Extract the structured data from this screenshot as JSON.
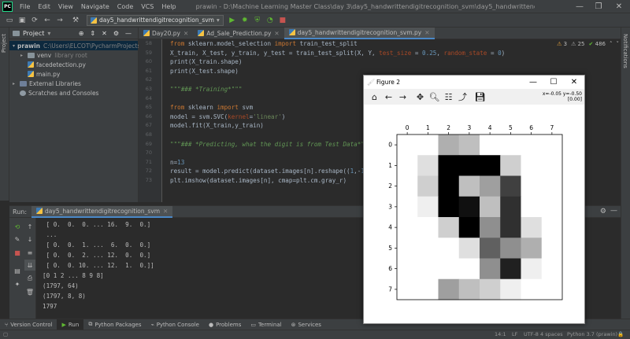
{
  "menu": {
    "items": [
      "File",
      "Edit",
      "View",
      "Navigate",
      "Code",
      "VCS",
      "Help"
    ],
    "title": "prawin - D:\\Machine Learning Master Class\\day 3\\day5_handwrittendigitrecognition_svm\\day5_handwrittendigitrecognition_svm.py"
  },
  "toolbar": {
    "run_config": "day5_handwrittendigitrecognition_svm"
  },
  "strips": {
    "left": "Project",
    "right": "Notifications"
  },
  "project": {
    "header": "Project",
    "nodes": [
      {
        "label": "prawin",
        "extra": "C:\\Users\\ELCOT\\PycharmProjects\\pr",
        "indent": 0,
        "kind": "folder-yellow",
        "arrow": "▾"
      },
      {
        "label": "venv",
        "extra": "library root",
        "indent": 1,
        "kind": "folder",
        "arrow": "▸"
      },
      {
        "label": "facedetection.py",
        "extra": "",
        "indent": 1,
        "kind": "py",
        "arrow": ""
      },
      {
        "label": "main.py",
        "extra": "",
        "indent": 1,
        "kind": "py",
        "arrow": ""
      },
      {
        "label": "External Libraries",
        "extra": "",
        "indent": 0,
        "kind": "lib",
        "arrow": "▸"
      },
      {
        "label": "Scratches and Consoles",
        "extra": "",
        "indent": 0,
        "kind": "scratch",
        "arrow": ""
      }
    ]
  },
  "tabs": [
    {
      "label": "Day20.py",
      "active": false
    },
    {
      "label": "Ad_Sale_Prediction.py",
      "active": false
    },
    {
      "label": "day5_handwrittendigitrecognition_svm.py",
      "active": true
    }
  ],
  "inspection": {
    "warnings": "3",
    "weak": "25",
    "typos": "486"
  },
  "editor": {
    "line_numbers": [
      "58",
      "59",
      "60",
      "61",
      "62",
      "63",
      "64",
      "65",
      "66",
      "67",
      "68",
      "69",
      "70",
      "71",
      "72",
      "73"
    ],
    "lines": [
      [
        {
          "t": "from ",
          "c": "kw"
        },
        {
          "t": "sklearn.model_selection ",
          "c": ""
        },
        {
          "t": "import ",
          "c": "kw"
        },
        {
          "t": "train_test_split",
          "c": ""
        }
      ],
      [
        {
          "t": "X_train, X_test, y_train, y_test = train_test_split(X, Y, ",
          "c": ""
        },
        {
          "t": "test_size",
          "c": "kwarg"
        },
        {
          "t": " = ",
          "c": ""
        },
        {
          "t": "0.25",
          "c": "num"
        },
        {
          "t": ", ",
          "c": ""
        },
        {
          "t": "random_state",
          "c": "kwarg"
        },
        {
          "t": " = ",
          "c": ""
        },
        {
          "t": "0",
          "c": "num"
        },
        {
          "t": ")",
          "c": ""
        }
      ],
      [
        {
          "t": "print(X_train.shape)",
          "c": ""
        }
      ],
      [
        {
          "t": "print(X_test.shape)",
          "c": ""
        }
      ],
      [
        {
          "t": "",
          "c": ""
        }
      ],
      [
        {
          "t": "\"\"\"### *Training*\"\"\"",
          "c": "cm"
        }
      ],
      [
        {
          "t": "",
          "c": ""
        }
      ],
      [
        {
          "t": "from ",
          "c": "kw"
        },
        {
          "t": "sklearn ",
          "c": ""
        },
        {
          "t": "import ",
          "c": "kw"
        },
        {
          "t": "svm",
          "c": ""
        }
      ],
      [
        {
          "t": "model = svm.SVC(",
          "c": ""
        },
        {
          "t": "kernel",
          "c": "kwarg"
        },
        {
          "t": "=",
          "c": ""
        },
        {
          "t": "'linear'",
          "c": "str"
        },
        {
          "t": ")",
          "c": ""
        }
      ],
      [
        {
          "t": "model.fit(X_train,y_train)",
          "c": ""
        }
      ],
      [
        {
          "t": "",
          "c": ""
        }
      ],
      [
        {
          "t": "\"\"\"### *Predicting, what the digit is from Test Data*\"\"\"",
          "c": "cm"
        }
      ],
      [
        {
          "t": "",
          "c": ""
        }
      ],
      [
        {
          "t": "n=",
          "c": ""
        },
        {
          "t": "13",
          "c": "num"
        }
      ],
      [
        {
          "t": "result = model.predict(dataset.images[n].reshape((",
          "c": ""
        },
        {
          "t": "1",
          "c": "num"
        },
        {
          "t": ",-",
          "c": ""
        },
        {
          "t": "1",
          "c": "num"
        },
        {
          "t": ")))",
          "c": ""
        }
      ],
      [
        {
          "t": "plt.imshow(dataset.images[n], cmap=plt.cm.gray_r)",
          "c": ""
        }
      ]
    ]
  },
  "run": {
    "label": "Run:",
    "tab": "day5_handwrittendigitrecognition_svm",
    "output": [
      " [ 0.  0.  0. ... 16.  9.  0.]",
      " ...",
      " [ 0.  0.  1. ...  6.  0.  0.]",
      " [ 0.  0.  2. ... 12.  0.  0.]",
      " [ 0.  0. 10. ... 12.  1.  0.]]",
      "[0 1 2 ... 8 9 8]",
      "(1797, 64)",
      "(1797, 8, 8)",
      "1797"
    ]
  },
  "bottom_tabs": [
    "Version Control",
    "Run",
    "Python Packages",
    "Python Console",
    "Problems",
    "Terminal",
    "Services"
  ],
  "status": {
    "position": "14:1",
    "eol": "LF",
    "encoding": "UTF-8",
    "indent": "4 spaces",
    "interpreter": "Python 3.7 (prawin)"
  },
  "figure": {
    "title": "Figure 2",
    "coords_line1": "x=-0.05 y=-0.50",
    "coords_line2": "[0.00]"
  },
  "chart_data": {
    "type": "heatmap",
    "colormap": "gray_r",
    "x_ticks": [
      "0",
      "1",
      "2",
      "3",
      "4",
      "5",
      "6",
      "7"
    ],
    "y_ticks": [
      "0",
      "1",
      "2",
      "3",
      "4",
      "5",
      "6",
      "7"
    ],
    "values": [
      [
        0,
        0,
        5,
        4,
        0,
        0,
        0,
        0
      ],
      [
        0,
        2,
        16,
        16,
        16,
        3,
        0,
        0
      ],
      [
        0,
        3,
        16,
        4,
        6,
        12,
        0,
        0
      ],
      [
        0,
        1,
        16,
        15,
        4,
        13,
        0,
        0
      ],
      [
        0,
        0,
        3,
        16,
        7,
        13,
        2,
        0
      ],
      [
        0,
        0,
        0,
        2,
        10,
        7,
        5,
        0
      ],
      [
        0,
        0,
        0,
        0,
        7,
        14,
        1,
        0
      ],
      [
        0,
        0,
        6,
        4,
        3,
        1,
        0,
        0
      ]
    ],
    "vmin": 0,
    "vmax": 16
  }
}
